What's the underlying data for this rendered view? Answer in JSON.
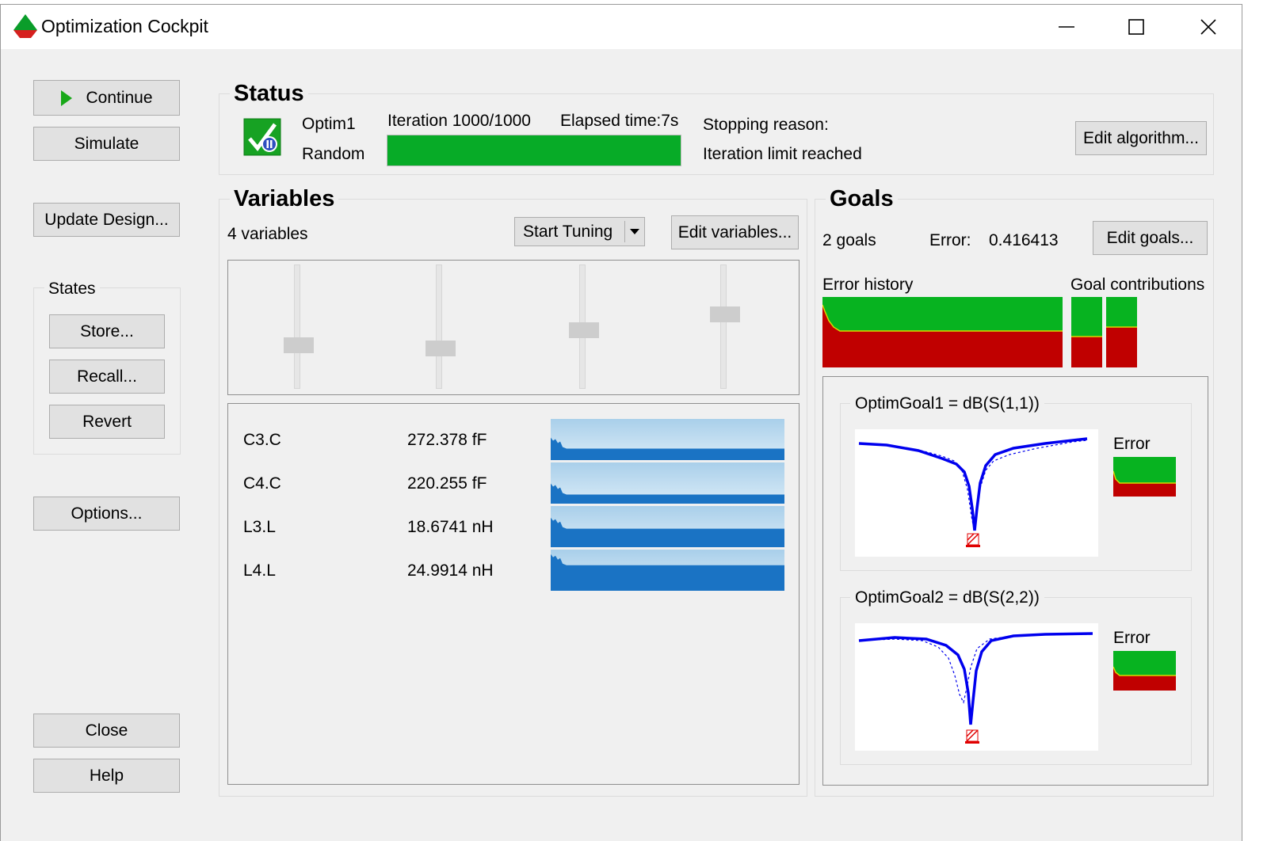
{
  "window": {
    "title": "Optimization Cockpit"
  },
  "left": {
    "continue_label": "Continue",
    "simulate_label": "Simulate",
    "update_design_label": "Update Design...",
    "states": {
      "title": "States",
      "store_label": "Store...",
      "recall_label": "Recall...",
      "revert_label": "Revert"
    },
    "options_label": "Options...",
    "close_label": "Close",
    "help_label": "Help"
  },
  "status": {
    "title": "Status",
    "optim_name": "Optim1",
    "algorithm": "Random",
    "iteration": "Iteration 1000/1000",
    "elapsed": "Elapsed time:7s",
    "progress_fraction": 1.0,
    "stopping_label": "Stopping reason:",
    "stopping_reason": "Iteration limit reached",
    "edit_algorithm_label": "Edit algorithm..."
  },
  "variables": {
    "title": "Variables",
    "count_text": "4 variables",
    "start_tuning_label": "Start Tuning",
    "edit_label": "Edit variables...",
    "slider_levels": [
      0.33,
      0.3,
      0.47,
      0.61
    ],
    "items": [
      {
        "name": "C3.C",
        "value": "272.378 fF",
        "spark_level": 0.28
      },
      {
        "name": "C4.C",
        "value": "220.255 fF",
        "spark_level": 0.22
      },
      {
        "name": "L3.L",
        "value": "18.6741 nH",
        "spark_level": 0.45
      },
      {
        "name": "L4.L",
        "value": "24.9914 nH",
        "spark_level": 0.62
      }
    ]
  },
  "goals": {
    "title": "Goals",
    "count_text": "2 goals",
    "error_label": "Error:",
    "error_value": "0.416413",
    "edit_label": "Edit goals...",
    "error_history_label": "Error history",
    "goal_contributions_label": "Goal contributions",
    "goal1": {
      "label": "OptimGoal1 = dB(S(1,1))",
      "error_label": "Error"
    },
    "goal2": {
      "label": "OptimGoal2 = dB(S(2,2))",
      "error_label": "Error"
    }
  },
  "colors": {
    "progress_green": "#07ab27",
    "error_red": "#c00000",
    "error_green": "#07b320",
    "trace_blue": "#0000ee",
    "spark_dark": "#1a73c4",
    "spark_light": "#b8d8ef"
  }
}
